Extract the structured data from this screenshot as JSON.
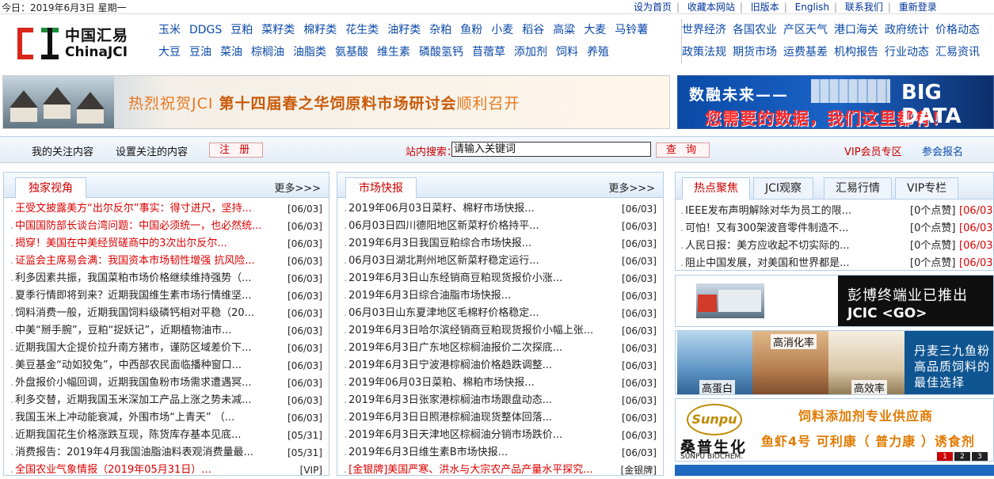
{
  "topbar": {
    "date": "今日：2019年6月3日 星期一",
    "links": [
      "设为首页",
      "收藏本网站",
      "旧版本",
      "English",
      "联系我们",
      "重新登录"
    ]
  },
  "logo": {
    "cn": "中国汇易",
    "en": "ChinaJCI"
  },
  "nav": {
    "row1": [
      "玉米",
      "DDGS",
      "豆粕",
      "菜籽类",
      "棉籽类",
      "花生类",
      "油籽类",
      "杂粕",
      "鱼粉",
      "小麦",
      "稻谷",
      "高粱",
      "大麦",
      "马铃薯"
    ],
    "row2": [
      "大豆",
      "豆油",
      "菜油",
      "棕榈油",
      "油脂类",
      "氨基酸",
      "维生素",
      "磷酸氢钙",
      "苜蓿草",
      "添加剂",
      "饲料",
      "养殖"
    ],
    "right_row1": [
      "世界经济",
      "各国农业",
      "产区天气",
      "港口海关",
      "政府统计",
      "价格动态"
    ],
    "right_row2": [
      "政策法规",
      "期货市场",
      "运费基差",
      "机构报告",
      "行业动态",
      "汇易资讯"
    ]
  },
  "banners": {
    "left": {
      "pre": "热烈祝贺JCI ",
      "bold": "第十四届春之华饲原料市场研讨会",
      "post": "顺利召开"
    },
    "right": {
      "line1": "数融未来——",
      "line2": "您需要的数据，我们这里都有！",
      "big": "BIG DATA"
    }
  },
  "toolbar": {
    "my_follow": "我的关注内容",
    "set_follow": "设置关注的内容",
    "register": "注 册",
    "search_label": "站内搜索：",
    "search_value": "请输入关键词",
    "search_button": "查 询",
    "vip": "VIP会员专区",
    "meeting": "参会报名"
  },
  "panel_left": {
    "tab": "独家视角",
    "more": "更多>>>",
    "items": [
      {
        "title": "王受文披露美方“出尔反尔”事实：得寸进尺，坚持...",
        "date": "[06/03]",
        "red": true
      },
      {
        "title": "中国国防部长谈台湾问题：中国必须统一，也必然统...",
        "date": "[06/03]",
        "red": true
      },
      {
        "title": "揭穿！美国在中美经贸磋商中的3次出尔反尔...",
        "date": "[06/03]",
        "red": true
      },
      {
        "title": "证监会主席易会满：我国资本市场韧性增强  抗风险...",
        "date": "[06/03]",
        "red": true
      },
      {
        "title": "利多因素共振，我国菜粕市场价格继续维持强势（...",
        "date": "[06/03]",
        "red": false
      },
      {
        "title": "夏季行情即将到来？近期我国维生素市场行情维坚...",
        "date": "[06/03]",
        "red": false
      },
      {
        "title": "饲料消费一般，近期我国饲料级磷钙相对平稳（20...",
        "date": "[06/03]",
        "red": false
      },
      {
        "title": "中美“掰手腕”，豆粕“捉妖记”，近期植物油市...",
        "date": "[06/03]",
        "red": false
      },
      {
        "title": "近期我国大企提价拉升南方猪市，谨防区域差价下...",
        "date": "[06/03]",
        "red": false
      },
      {
        "title": "美豆基金“动如狡兔”，中西部农民面临播种窗口...",
        "date": "[06/03]",
        "red": false
      },
      {
        "title": "外盘报价小幅回调，近期我国鱼粉市场需求遭遇冥...",
        "date": "[06/03]",
        "red": false
      },
      {
        "title": "利多交替，近期我国玉米深加工产品上涨之势未减...",
        "date": "[06/03]",
        "red": false
      },
      {
        "title": "我国玉米上冲动能衰减，外围市场“上青天”  （...",
        "date": "[06/03]",
        "red": false
      },
      {
        "title": "近期我国花生价格涨跌互现，陈货库存基本见底...",
        "date": "[05/31]",
        "red": false
      },
      {
        "title": "消费报告：2019年4月我国油脂油料表观消费量最...",
        "date": "[05/31]",
        "red": false
      },
      {
        "title": "全国农业气象情报（2019年05月31日）...",
        "date": "[VIP]",
        "red": true
      }
    ]
  },
  "panel_mid": {
    "tab": "市场快报",
    "more": "更多>>>",
    "items": [
      {
        "title": "2019年06月03日菜籽、棉籽市场快报...",
        "date": "[06/03]",
        "red": false
      },
      {
        "title": "06月03日四川德阳地区新菜籽价格持平...",
        "date": "[06/03]",
        "red": false
      },
      {
        "title": "2019年6月3日我国豆粕综合市场快报...",
        "date": "[06/03]",
        "red": false
      },
      {
        "title": "06月03日湖北荆州地区新菜籽稳定运行...",
        "date": "[06/03]",
        "red": false
      },
      {
        "title": "2019年6月3日山东经销商豆粕现货报价小涨...",
        "date": "[06/03]",
        "red": false
      },
      {
        "title": "2019年6月3日综合油脂市场快报...",
        "date": "[06/03]",
        "red": false
      },
      {
        "title": "06月03日山东夏津地区毛棉籽价格稳定...",
        "date": "[06/03]",
        "red": false
      },
      {
        "title": "2019年6月3日哈尔滨经销商豆粕现货报价小幅上张...",
        "date": "[06/03]",
        "red": false
      },
      {
        "title": "2019年6月3日广东地区棕榈油报价二次探底...",
        "date": "[06/03]",
        "red": false
      },
      {
        "title": "2019年6月3日宁波港棕榈油价格趋跌调整...",
        "date": "[06/03]",
        "red": false
      },
      {
        "title": "2019年06月03日菜粕、棉粕市场快报...",
        "date": "[06/03]",
        "red": false
      },
      {
        "title": "2019年6月3日张家港棕榈油市场跟盘动态...",
        "date": "[06/03]",
        "red": false
      },
      {
        "title": "2019年6月3日日照港棕榈油现货整体回落...",
        "date": "[06/03]",
        "red": false
      },
      {
        "title": "2019年6月3日天津地区棕榈油分销市场跌价...",
        "date": "[06/03]",
        "red": false
      },
      {
        "title": "2019年6月3日维生素B市场快报...",
        "date": "[06/03]",
        "red": false
      },
      {
        "title": "[金银牌]美国严寒、洪水与大宗农产品产量水平探究...",
        "date": "[金银牌]",
        "red": true
      }
    ]
  },
  "panel_right": {
    "tabs": [
      "热点聚焦",
      "JCI观察",
      "汇易行情",
      "VIP专栏"
    ],
    "items": [
      {
        "title": "IEEE发布声明解除对华为员工的限...",
        "count": "[0个点赞]",
        "date": "[06/03]"
      },
      {
        "title": "可怕！又有300架波音零件制造不...",
        "count": "[0个点赞]",
        "date": "[06/03]"
      },
      {
        "title": "人民日报：美方应收起不切实际的...",
        "count": "[0个点赞]",
        "date": "[06/03]"
      },
      {
        "title": "阻止中国发展，对美国和世界都是...",
        "count": "[0个点赞]",
        "date": "[06/03]"
      }
    ]
  },
  "ads": {
    "ad1": {
      "line1": "彭博终端业已推出",
      "line2": "JCIC <GO>"
    },
    "ad2": {
      "top": "高消化率",
      "left": "高蛋白",
      "right": "高效率",
      "b1": "丹麦三九鱼粉",
      "b2": "高品质饲料的",
      "b3": "最佳选择"
    },
    "ad3": {
      "logo": "Sunpu",
      "cn": "桑普生化",
      "en": "SUNPU BIOCHEM.",
      "head": "饲料添加剂专业供应商",
      "sub": "鱼虾4号  可利康（ 普力康 ）诱食剂",
      "pages": [
        "1",
        "2",
        "3"
      ]
    }
  },
  "colors": {
    "accent": "#c00000",
    "link": "#0b4aa8",
    "panel_border": "#b5cde6"
  }
}
